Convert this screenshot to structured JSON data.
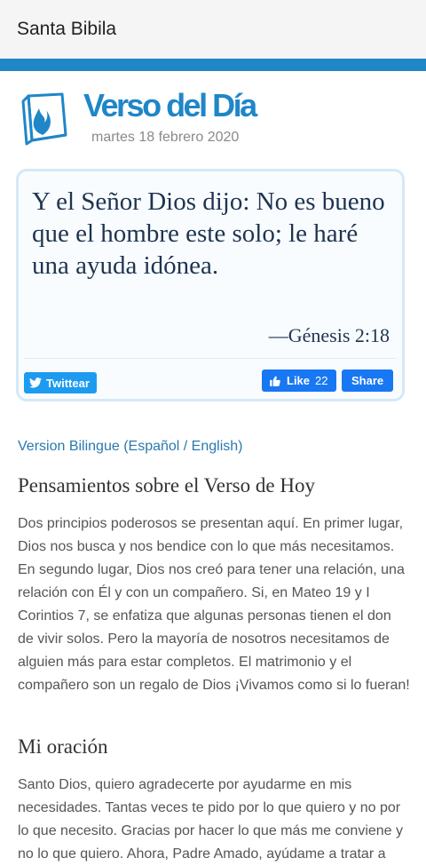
{
  "app": {
    "title": "Santa Bibila"
  },
  "header": {
    "title": "Verso del Día",
    "date": "martes 18 febrero 2020",
    "logo_icon": "bible-flame-icon"
  },
  "verse": {
    "text": "Y el Señor Dios dijo: No es bueno que el hombre este solo; le haré una ayuda idónea.",
    "reference": "—Génesis 2:18"
  },
  "social": {
    "twitter_label": "Twittear",
    "like_label": "Like",
    "like_count": "22",
    "share_label": "Share"
  },
  "links": {
    "bilingual": "Version Bilingue (Español / English)"
  },
  "thoughts": {
    "heading": "Pensamientos sobre el Verso de Hoy",
    "body": "Dos principios poderosos se presentan aquí. En primer lugar, Dios nos busca y nos bendice con lo que más necesitamos. En segundo lugar, Dios nos creó para tener una relación, una relación con Él y con un compañero. Si, en Mateo 19 y I Corintios 7, se enfatiza que algunas personas tienen el don de vivir solos. Pero la mayoría de nosotros necesitamos de alguien más para estar completos. El matrimonio y el compañero son un regalo de Dios ¡Vivamos como si lo fueran!"
  },
  "prayer": {
    "heading": "Mi oración",
    "body": "Santo Dios, quiero agradecerte por ayudarme en mis necesidades. Tantas veces te pido por lo que quiero y no por lo que necesito. Gracias por hacer lo que más me conviene y no lo que quiero. Ahora, Padre Amado, ayúdame a tratar a"
  },
  "colors": {
    "accent": "#1f86c8",
    "twitter": "#1d9bf0",
    "facebook": "#1877f2",
    "verse_text": "#1e3450"
  }
}
